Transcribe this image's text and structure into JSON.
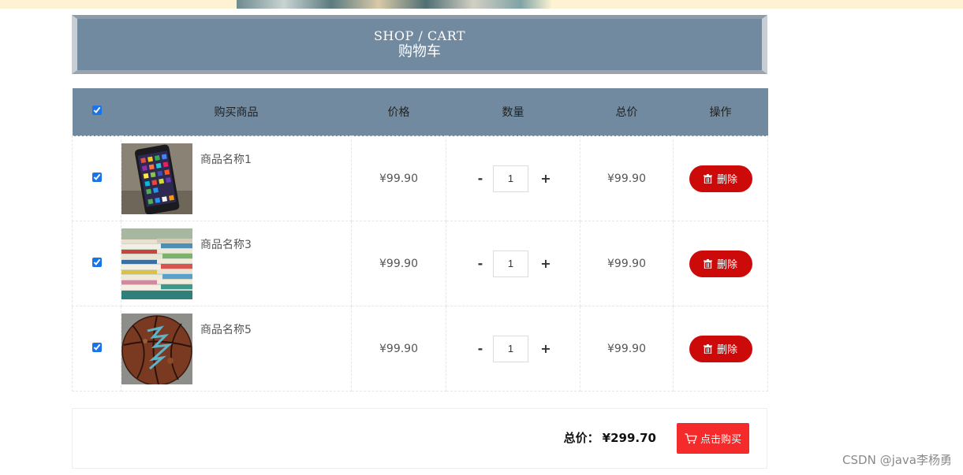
{
  "header": {
    "title_en": "SHOP / CART",
    "title_cn": "购物车"
  },
  "table": {
    "columns": [
      "购买商品",
      "价格",
      "数量",
      "总价",
      "操作"
    ],
    "select_all_checked": true,
    "rows": [
      {
        "checked": true,
        "name": "商品名称1",
        "price": "¥99.90",
        "qty": "1",
        "subtotal": "¥99.90",
        "image": "phone-photo"
      },
      {
        "checked": true,
        "name": "商品名称3",
        "price": "¥99.90",
        "qty": "1",
        "subtotal": "¥99.90",
        "image": "books-photo"
      },
      {
        "checked": true,
        "name": "商品名称5",
        "price": "¥99.90",
        "qty": "1",
        "subtotal": "¥99.90",
        "image": "basketball-photo"
      }
    ],
    "minus_label": "-",
    "plus_label": "+",
    "delete_label": "删除",
    "delete_icon": "trash-icon"
  },
  "footer": {
    "total_label": "总价：",
    "total_amount": "¥299.70",
    "buy_label": "点击购买",
    "buy_icon": "cart-icon"
  },
  "watermark": "CSDN @java李杨勇",
  "colors": {
    "header_bg": "#718aa0",
    "delete_button": "#cd0a0a",
    "buy_button": "#f52b2b",
    "top_banner": "#fdf3d3"
  }
}
